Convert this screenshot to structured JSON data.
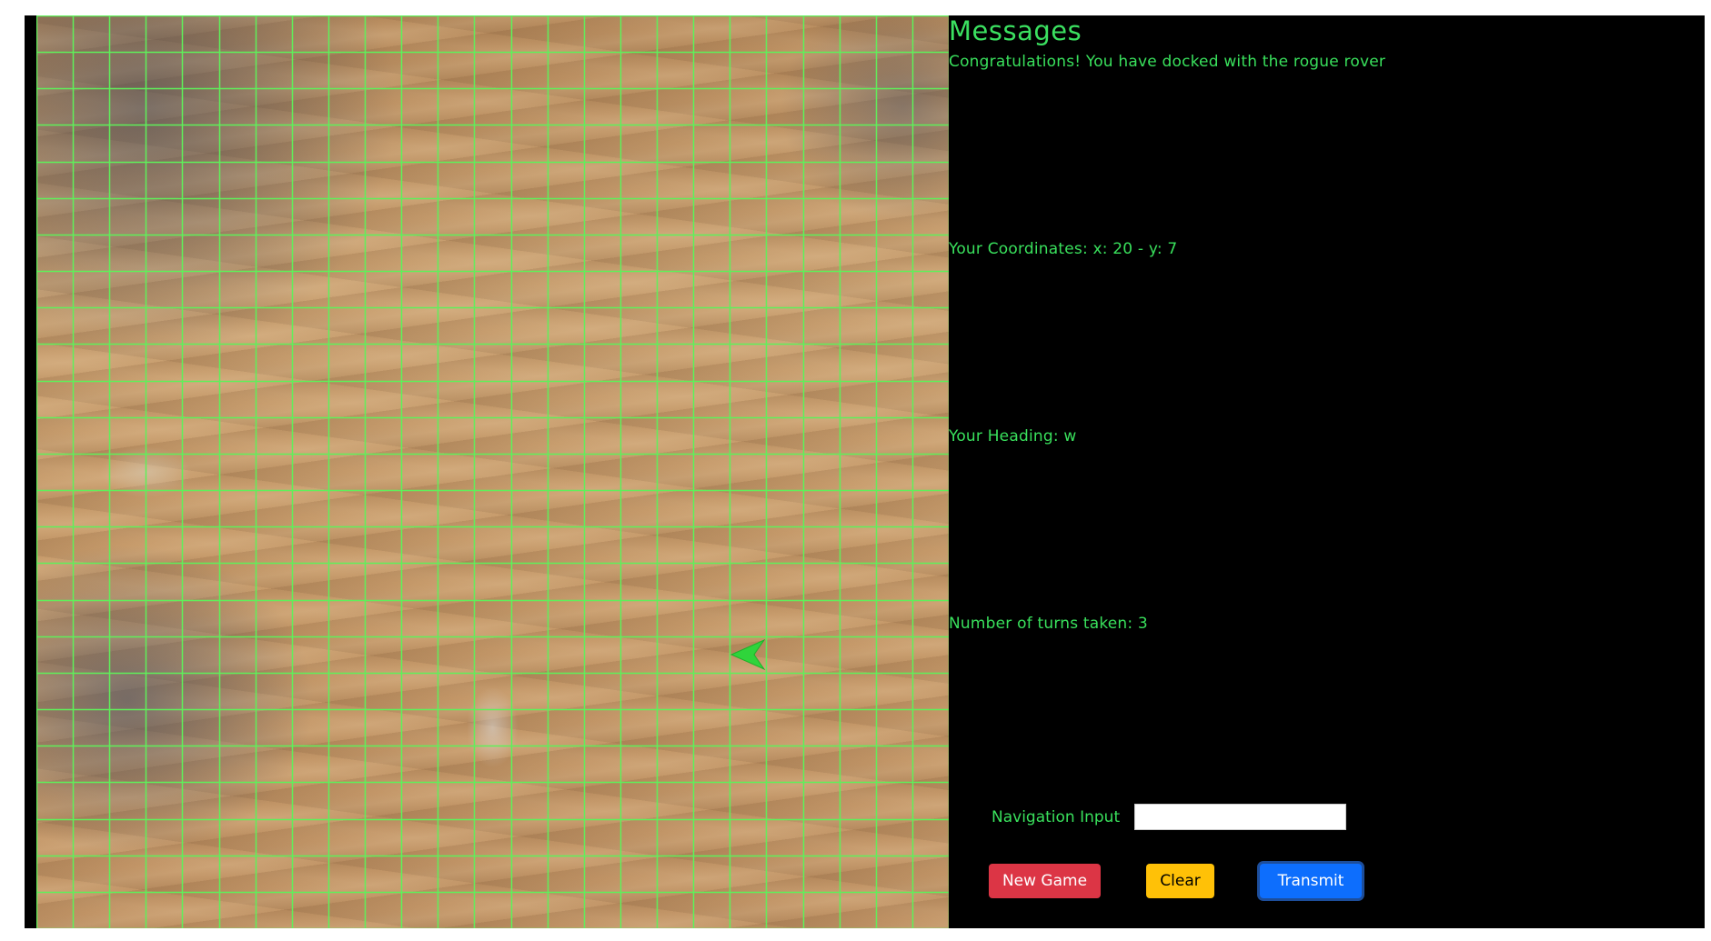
{
  "colors": {
    "accent_green": "#39e05c",
    "grid_line": "#5ff05a",
    "background": "#000000",
    "new_game": "#dc3545",
    "clear": "#ffc107",
    "transmit": "#0d6efd"
  },
  "map": {
    "grid_columns": 25,
    "grid_rows": 25,
    "rover": {
      "icon": "arrow-icon",
      "x": 20,
      "y": 7,
      "heading": "w"
    }
  },
  "panel": {
    "title": "Messages",
    "status": "Congratulations! You have docked with the rogue rover",
    "coordinates": "Your Coordinates: x: 20 - y: 7",
    "heading": "Your Heading: w",
    "turns": "Number of turns taken: 3"
  },
  "navigation": {
    "label": "Navigation Input",
    "value": "",
    "placeholder": ""
  },
  "buttons": {
    "new_game": "New Game",
    "clear": "Clear",
    "transmit": "Transmit"
  }
}
